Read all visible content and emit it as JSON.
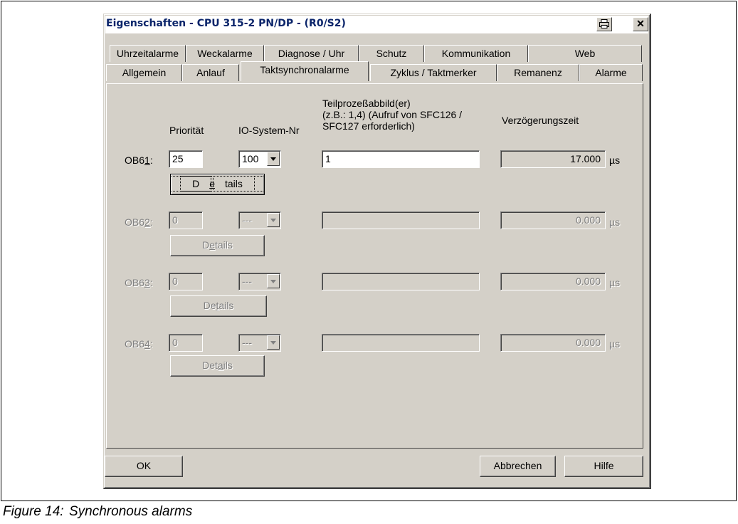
{
  "window": {
    "title": "Eigenschaften - CPU 315-2 PN/DP - (R0/S2)"
  },
  "tabs_row1": [
    "Uhrzeitalarme",
    "Weckalarme",
    "Diagnose / Uhr",
    "Schutz",
    "Kommunikation",
    "Web"
  ],
  "tabs_row2": [
    "Allgemein",
    "Anlauf",
    "Taktsynchronalarme",
    "Zyklus / Taktmerker",
    "Remanenz",
    "Alarme"
  ],
  "active_tab": "Taktsynchronalarme",
  "headers": {
    "priority": "Priorität",
    "io_system": "IO-System-Nr",
    "process_image": "Teilprozeßabbild(er)\n(z.B.: 1,4) (Aufruf von SFC126 /\nSFC127 erforderlich)",
    "delay": "Verzögerungszeit"
  },
  "rows": [
    {
      "ob_pre": "OB6",
      "ob_ul": "1",
      "ob_post": ":",
      "priority": "25",
      "io_system": "100",
      "process_image": "1",
      "delay": "17.000",
      "unit": "µs",
      "details_pre": "D",
      "details_ul": "e",
      "details_post": "tails",
      "enabled": true
    },
    {
      "ob_pre": "OB6",
      "ob_ul": "2",
      "ob_post": ":",
      "priority": "0",
      "io_system": "---",
      "process_image": "",
      "delay": "0.000",
      "unit": "µs",
      "details_pre": "D",
      "details_ul": "e",
      "details_post": "tails",
      "enabled": false
    },
    {
      "ob_pre": "OB6",
      "ob_ul": "3",
      "ob_post": ":",
      "priority": "0",
      "io_system": "---",
      "process_image": "",
      "delay": "0.000",
      "unit": "µs",
      "details_pre": "De",
      "details_ul": "t",
      "details_post": "ails",
      "enabled": false
    },
    {
      "ob_pre": "OB6",
      "ob_ul": "4",
      "ob_post": ":",
      "priority": "0",
      "io_system": "---",
      "process_image": "",
      "delay": "0.000",
      "unit": "µs",
      "details_pre": "Det",
      "details_ul": "a",
      "details_post": "ils",
      "enabled": false
    }
  ],
  "buttons": {
    "ok": "OK",
    "cancel": "Abbrechen",
    "help": "Hilfe"
  },
  "caption": {
    "number": "Figure 14:",
    "text": "Synchronous alarms"
  }
}
